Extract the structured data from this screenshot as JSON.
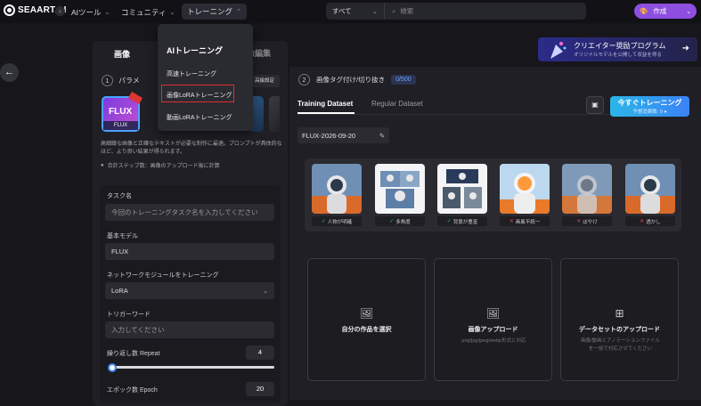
{
  "topbar": {
    "logo": "SEAART.AI",
    "nav": [
      {
        "label": "AIツール"
      },
      {
        "label": "コミュニティ"
      },
      {
        "label": "トレーニング"
      }
    ],
    "search_filter": "すべて",
    "search_placeholder": "検索",
    "create_label": "作成"
  },
  "dropdown": {
    "title": "AIトレーニング",
    "items": [
      "高速トレーニング",
      "画像LoRAトレーニング",
      "動画LoRAトレーニング"
    ]
  },
  "promo": {
    "title": "クリエイター奨励プログラム",
    "subtitle": "オリジナルモデルを公開して収益を得る"
  },
  "left": {
    "tab_image": "画像",
    "tab_edit": "画像編集",
    "step1_num": "1",
    "step1_label": "パラメ",
    "advanced": "高級設定",
    "model_card": "FLUX",
    "model_card_sub": "FLUX",
    "description": "高細緻な画像と正確なテキストが必要な制作に最適。プロンプトが具体的なほど、より良い結果が得られます。",
    "calc": "合計ステップ数：画像のアップロード後に計算",
    "task_label": "タスク名",
    "task_placeholder": "今回のトレーニングタスク名を入力してください",
    "base_model_label": "基本モデル",
    "base_model_value": "FLUX",
    "network_label": "ネットワークモジュールをトレーニング",
    "network_value": "LoRA",
    "trigger_label": "トリガーワード",
    "trigger_placeholder": "入力してください",
    "repeat_label": "繰り返し数 Repeat",
    "repeat_value": "4",
    "repeat_slider": 0.0,
    "epoch_label": "エポック数 Epoch",
    "epoch_value": "20"
  },
  "right": {
    "step2_num": "2",
    "step2_label": "画像タグ付け/切り抜き",
    "count": "0/500",
    "tab_training": "Training Dataset",
    "tab_regular": "Regular Dataset",
    "train_button": "今すぐトレーニング",
    "train_cost": "予想消費数: 0",
    "dataset_name": "FLUX-2026-09-20",
    "thumbs": [
      {
        "label": "人物が明確",
        "status": "ok"
      },
      {
        "label": "多角度",
        "status": "ok"
      },
      {
        "label": "背景が豊富",
        "status": "ok"
      },
      {
        "label": "画風不統一",
        "status": "ng"
      },
      {
        "label": "ぼやけ",
        "status": "ng"
      },
      {
        "label": "透かし",
        "status": "ng"
      }
    ],
    "cards": [
      {
        "title": "自分の作品を選択",
        "sub": ""
      },
      {
        "title": "画像アップロード",
        "sub": "png/jpg/jpeg/webp形式に対応"
      },
      {
        "title": "データセットのアップロード",
        "sub": "画像/動画とアノテーションファイルを一括で対応させてください"
      }
    ]
  }
}
